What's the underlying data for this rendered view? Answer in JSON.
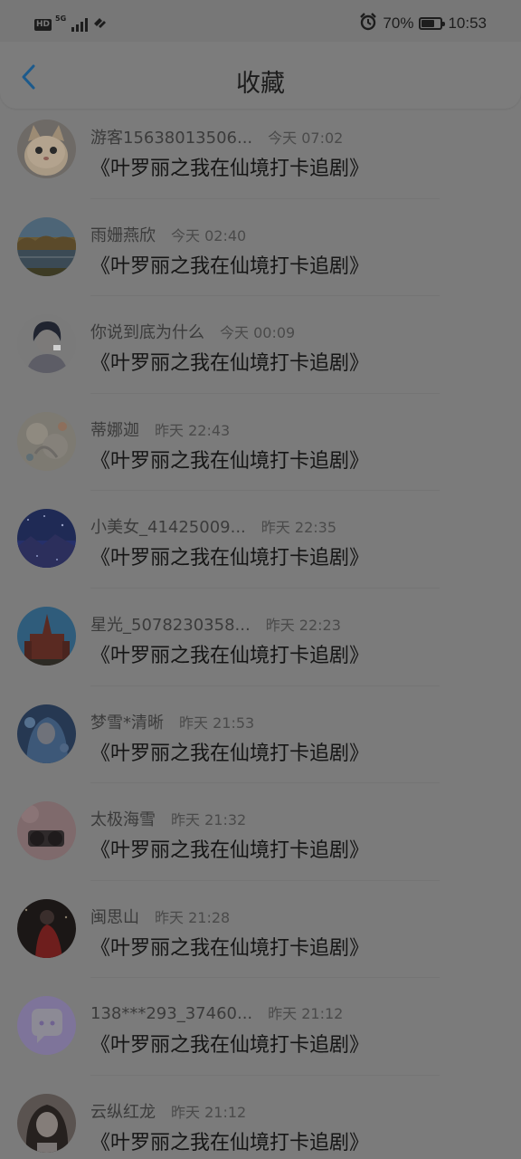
{
  "status_bar": {
    "network_badge": "HD",
    "network_type": "5G",
    "battery_percent": "70%",
    "battery_level": 0.7,
    "time": "10:53",
    "alarm_icon": "alarm-clock-icon",
    "signal_icon": "cell-signal-icon",
    "wifi_icon": "hotspot-icon"
  },
  "header": {
    "title": "收藏",
    "back_icon": "chevron-left-icon",
    "accent_color": "#1c5a8c"
  },
  "favorites": [
    {
      "user": "游客15638013506...",
      "time": "今天 07:02",
      "title": "《叶罗丽之我在仙境打卡追剧》",
      "avatar": "cat-avatar"
    },
    {
      "user": "雨姗燕欣",
      "time": "今天 02:40",
      "title": "《叶罗丽之我在仙境打卡追剧》",
      "avatar": "lake-landscape-avatar"
    },
    {
      "user": "你说到底为什么",
      "time": "今天 00:09",
      "title": "《叶罗丽之我在仙境打卡追剧》",
      "avatar": "anime-boy-avatar"
    },
    {
      "user": "蒂娜迦",
      "time": "昨天 22:43",
      "title": "《叶罗丽之我在仙境打卡追剧》",
      "avatar": "flower-art-avatar"
    },
    {
      "user": "小美女_41425009...",
      "time": "昨天 22:35",
      "title": "《叶罗丽之我在仙境打卡追剧》",
      "avatar": "starry-night-avatar"
    },
    {
      "user": "星光_5078230358...",
      "time": "昨天 22:23",
      "title": "《叶罗丽之我在仙境打卡追剧》",
      "avatar": "red-castle-avatar"
    },
    {
      "user": "梦雪*清晰",
      "time": "昨天 21:53",
      "title": "《叶罗丽之我在仙境打卡追剧》",
      "avatar": "anime-girl-blue-avatar"
    },
    {
      "user": "太极海雪",
      "time": "昨天 21:32",
      "title": "《叶罗丽之我在仙境打卡追剧》",
      "avatar": "camera-avatar"
    },
    {
      "user": "闽思山",
      "time": "昨天 21:28",
      "title": "《叶罗丽之我在仙境打卡追剧》",
      "avatar": "red-dress-girl-avatar"
    },
    {
      "user": "138***293_37460...",
      "time": "昨天 21:12",
      "title": "《叶罗丽之我在仙境打卡追剧》",
      "avatar": "chat-bubble-avatar"
    },
    {
      "user": "云纵红龙",
      "time": "昨天 21:12",
      "title": "《叶罗丽之我在仙境打卡追剧》",
      "avatar": "girl-photo-avatar"
    }
  ]
}
